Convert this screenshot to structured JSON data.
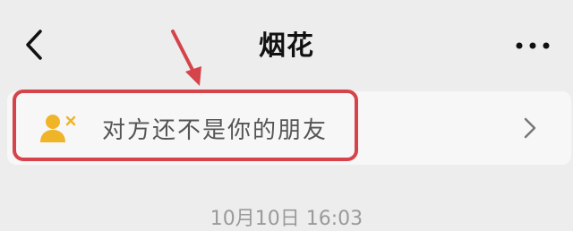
{
  "header": {
    "title": "烟花",
    "back_icon": "chevron-left-icon",
    "more_icon": "more-dots-icon"
  },
  "banner": {
    "text": "对方还不是你的朋友",
    "icon": "user-remove-icon",
    "chevron_icon": "chevron-right-icon",
    "icon_color": "#f0b429"
  },
  "annotation": {
    "color": "#d4444a"
  },
  "chat": {
    "timestamp": "10月10日 16:03"
  }
}
